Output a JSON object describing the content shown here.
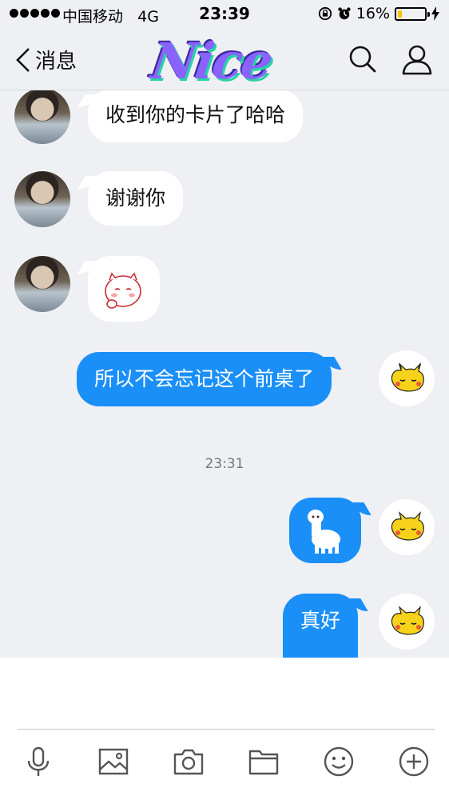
{
  "status_bar": {
    "carrier": "中国移动",
    "network": "4G",
    "time": "23:39",
    "battery_percent": "16%",
    "battery_level": 0.16,
    "battery_color": "#f5c400"
  },
  "nav": {
    "back_label": "消息",
    "logo_text": "Nice",
    "icons": [
      "search-icon",
      "profile-icon"
    ]
  },
  "messages": [
    {
      "side": "in",
      "text": "收到你的卡片了哈哈"
    },
    {
      "side": "in",
      "text": "谢谢你"
    },
    {
      "side": "in",
      "sticker": "cat-sticker"
    },
    {
      "side": "out",
      "text": "所以不会忘记这个前桌了"
    },
    {
      "side": "out",
      "sticker": "alpaca-sticker"
    },
    {
      "side": "out",
      "text": "真好"
    }
  ],
  "timestamp": "23:31",
  "toolbar": {
    "items": [
      "microphone-icon",
      "image-icon",
      "camera-icon",
      "folder-icon",
      "emoji-icon",
      "plus-icon"
    ]
  },
  "colors": {
    "accent": "#1a8ff7",
    "background": "#eff0f4"
  }
}
